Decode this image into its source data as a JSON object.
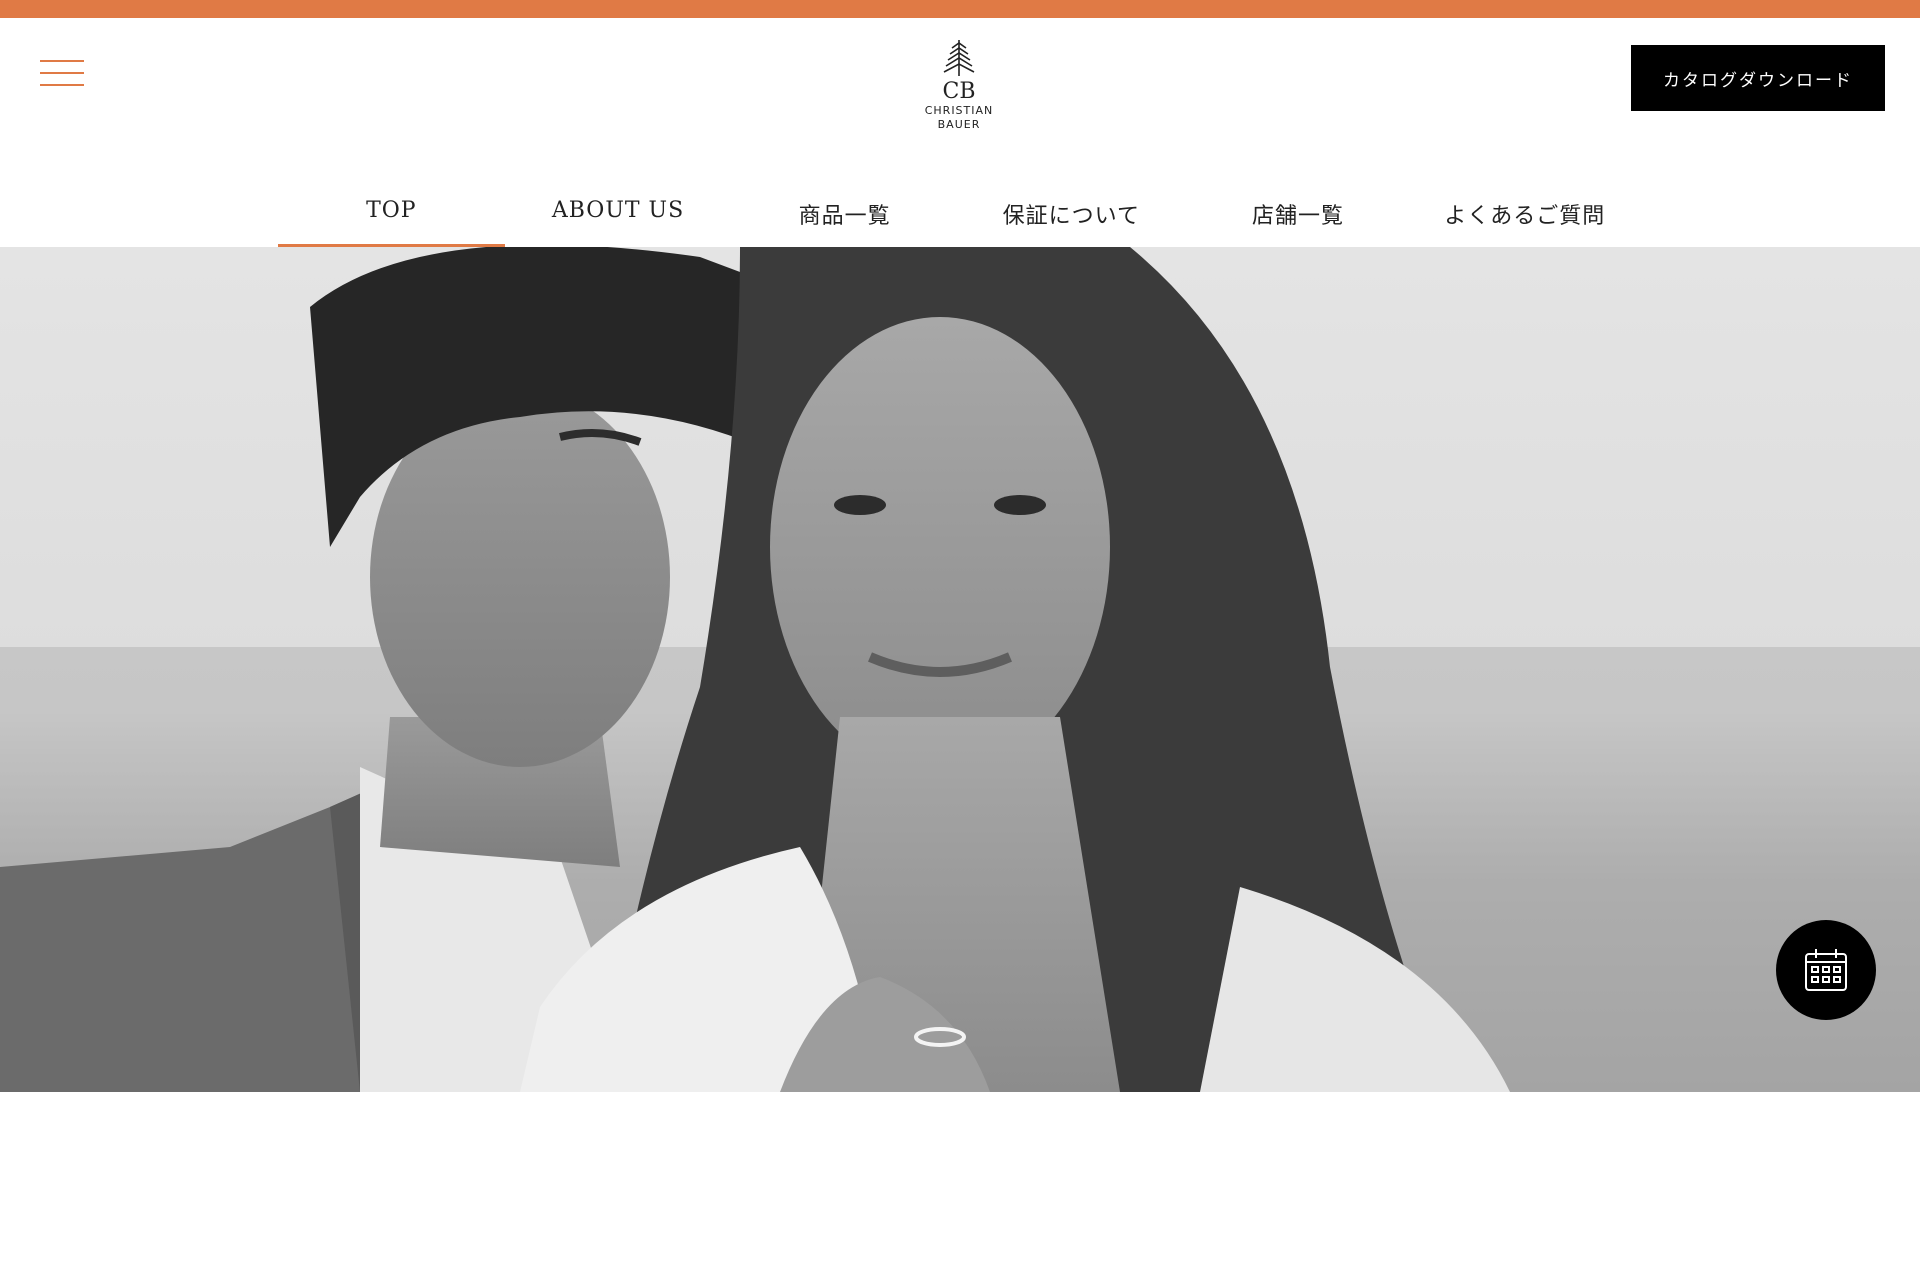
{
  "header": {
    "menu_icon": "hamburger-menu-icon",
    "logo": {
      "monogram": "CB",
      "line1": "CHRISTIAN",
      "line2": "BAUER"
    },
    "catalog_button_label": "カタログダウンロード"
  },
  "nav": {
    "items": [
      {
        "label": "TOP",
        "active": true
      },
      {
        "label": "ABOUT US",
        "active": false
      },
      {
        "label": "商品一覧",
        "active": false
      },
      {
        "label": "保証について",
        "active": false
      },
      {
        "label": "店舗一覧",
        "active": false
      },
      {
        "label": "よくあるご質問",
        "active": false
      }
    ]
  },
  "hero": {
    "image": "black-and-white-couple-photo"
  },
  "floating": {
    "calendar_icon": "calendar-icon"
  },
  "colors": {
    "accent": "#e07a45",
    "button_bg": "#000000",
    "text": "#222222"
  }
}
